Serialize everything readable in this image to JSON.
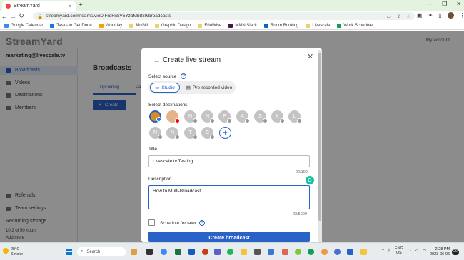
{
  "browser": {
    "tab_title": "StreamYard",
    "url": "streamyard.com/teams/vioDjFrdRckV6YzaMb8x9/broadcasts",
    "bookmarks": [
      {
        "label": "Google Calendar",
        "color": "#4285f4"
      },
      {
        "label": "Tasks to Get Done",
        "color": "#1a73e8"
      },
      {
        "label": "Workday",
        "color": "#f0a500"
      },
      {
        "label": "McGill",
        "color": "#e8d36b"
      },
      {
        "label": "Graphic Design",
        "color": "#e8d36b"
      },
      {
        "label": "EduWise",
        "color": "#e8d36b"
      },
      {
        "label": "MMN Slack",
        "color": "#4a154b"
      },
      {
        "label": "Room Booking",
        "color": "#0a66c2"
      },
      {
        "label": "Livescale",
        "color": "#e8d36b"
      },
      {
        "label": "Work Schedule",
        "color": "#0f9d58"
      }
    ]
  },
  "app": {
    "logo": "StreamYard",
    "my_account": "My account",
    "account_name": "marketing@livescale.tv",
    "sidebar": [
      {
        "label": "Broadcasts",
        "active": true
      },
      {
        "label": "Videos",
        "active": false
      },
      {
        "label": "Destinations",
        "active": false
      },
      {
        "label": "Members",
        "active": false
      }
    ],
    "sidebar_bottom": [
      "Referrals",
      "Team settings",
      "Recording storage",
      "10.2 of 50 hours",
      "Add more"
    ],
    "main_title": "Broadcasts",
    "tabs": [
      "Upcoming",
      "Past"
    ],
    "create_label": "Create"
  },
  "modal": {
    "title": "Create live stream",
    "select_source_label": "Select source",
    "source_options": [
      "Studio",
      "Pre-recorded video"
    ],
    "selected_source": "Studio",
    "select_destinations_label": "Select destinations",
    "destinations": [
      "",
      "",
      "N",
      "N",
      "P",
      "A",
      "S",
      "K",
      "L",
      "N",
      "N",
      "T",
      "C"
    ],
    "title_label": "Title",
    "title_value": "Livescale.tv Testing",
    "title_count": "20/100",
    "description_label": "Description",
    "description_value": "How to Multi-Broadcast",
    "description_count": "22/5000",
    "schedule_label": "Schedule for later",
    "submit_label": "Create broadcast"
  },
  "taskbar": {
    "weather_temp": "20°C",
    "weather_desc": "Smoke",
    "search_label": "Search",
    "lang": "ENG",
    "region": "US",
    "time": "2:28 PM",
    "date": "2023-06-06",
    "notifications": "20"
  },
  "colors": {
    "accent": "#2a63c7",
    "tabbar": "#e3f3e0"
  }
}
